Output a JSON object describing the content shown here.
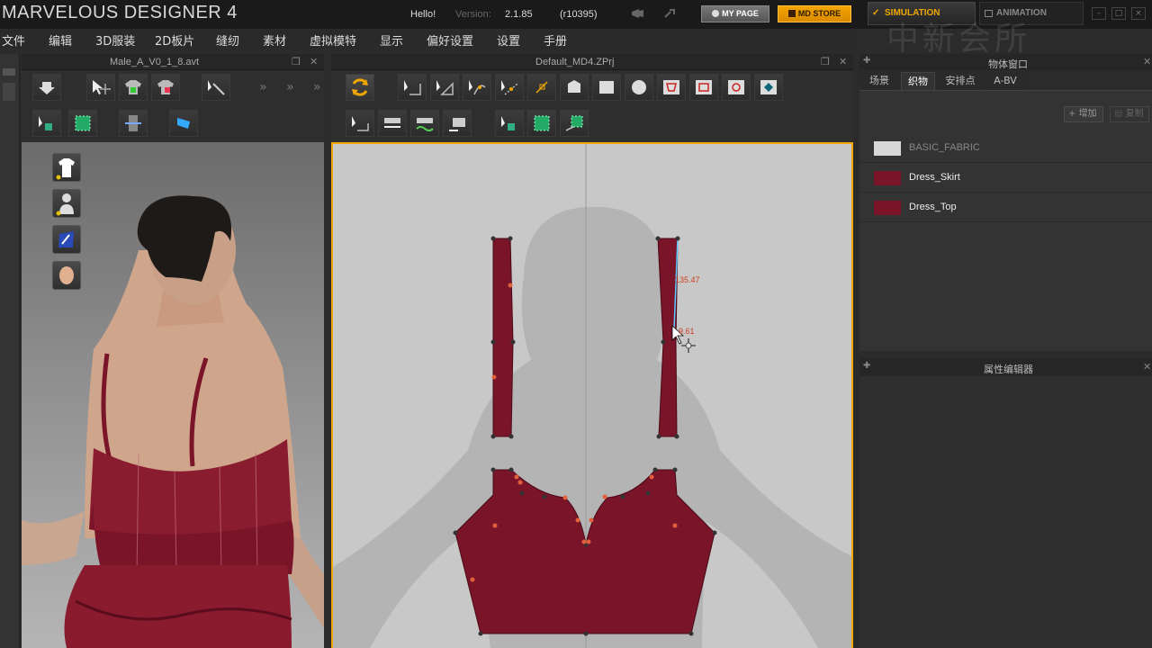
{
  "app": {
    "title": "MARVELOUS DESIGNER 4",
    "hello": "Hello!",
    "version_label": "Version:",
    "version": "2.1.85",
    "revision": "(r10395)",
    "mypage": "MY PAGE",
    "mdstore": "MD STORE",
    "mode_simulation": "SIMULATION",
    "mode_animation": "ANIMATION",
    "watermark": "中新会所",
    "accent": "#f0a800"
  },
  "menu": [
    "文件",
    "编辑",
    "3D服装",
    "2D板片",
    "缝纫",
    "素材",
    "虚拟模特",
    "显示",
    "偏好设置",
    "设置",
    "手册"
  ],
  "view3d": {
    "file": "Male_A_V0_1_8.avt"
  },
  "view2d": {
    "file": "Default_MD4.ZPrj",
    "measure_length": "135.47",
    "measure_point": "9.61"
  },
  "object_window": {
    "title": "物体窗口",
    "tabs": [
      "场景",
      "织物",
      "安排点",
      "A-BV"
    ],
    "active_tab": "织物",
    "add_button": "增加",
    "copy_button": "复制",
    "fabrics": [
      {
        "name": "BASIC_FABRIC",
        "color": "#d8d8d8"
      },
      {
        "name": "Dress_Skirt",
        "color": "#7a1428"
      },
      {
        "name": "Dress_Top",
        "color": "#7a1428"
      }
    ]
  },
  "property_editor": {
    "title": "属性编辑器"
  }
}
